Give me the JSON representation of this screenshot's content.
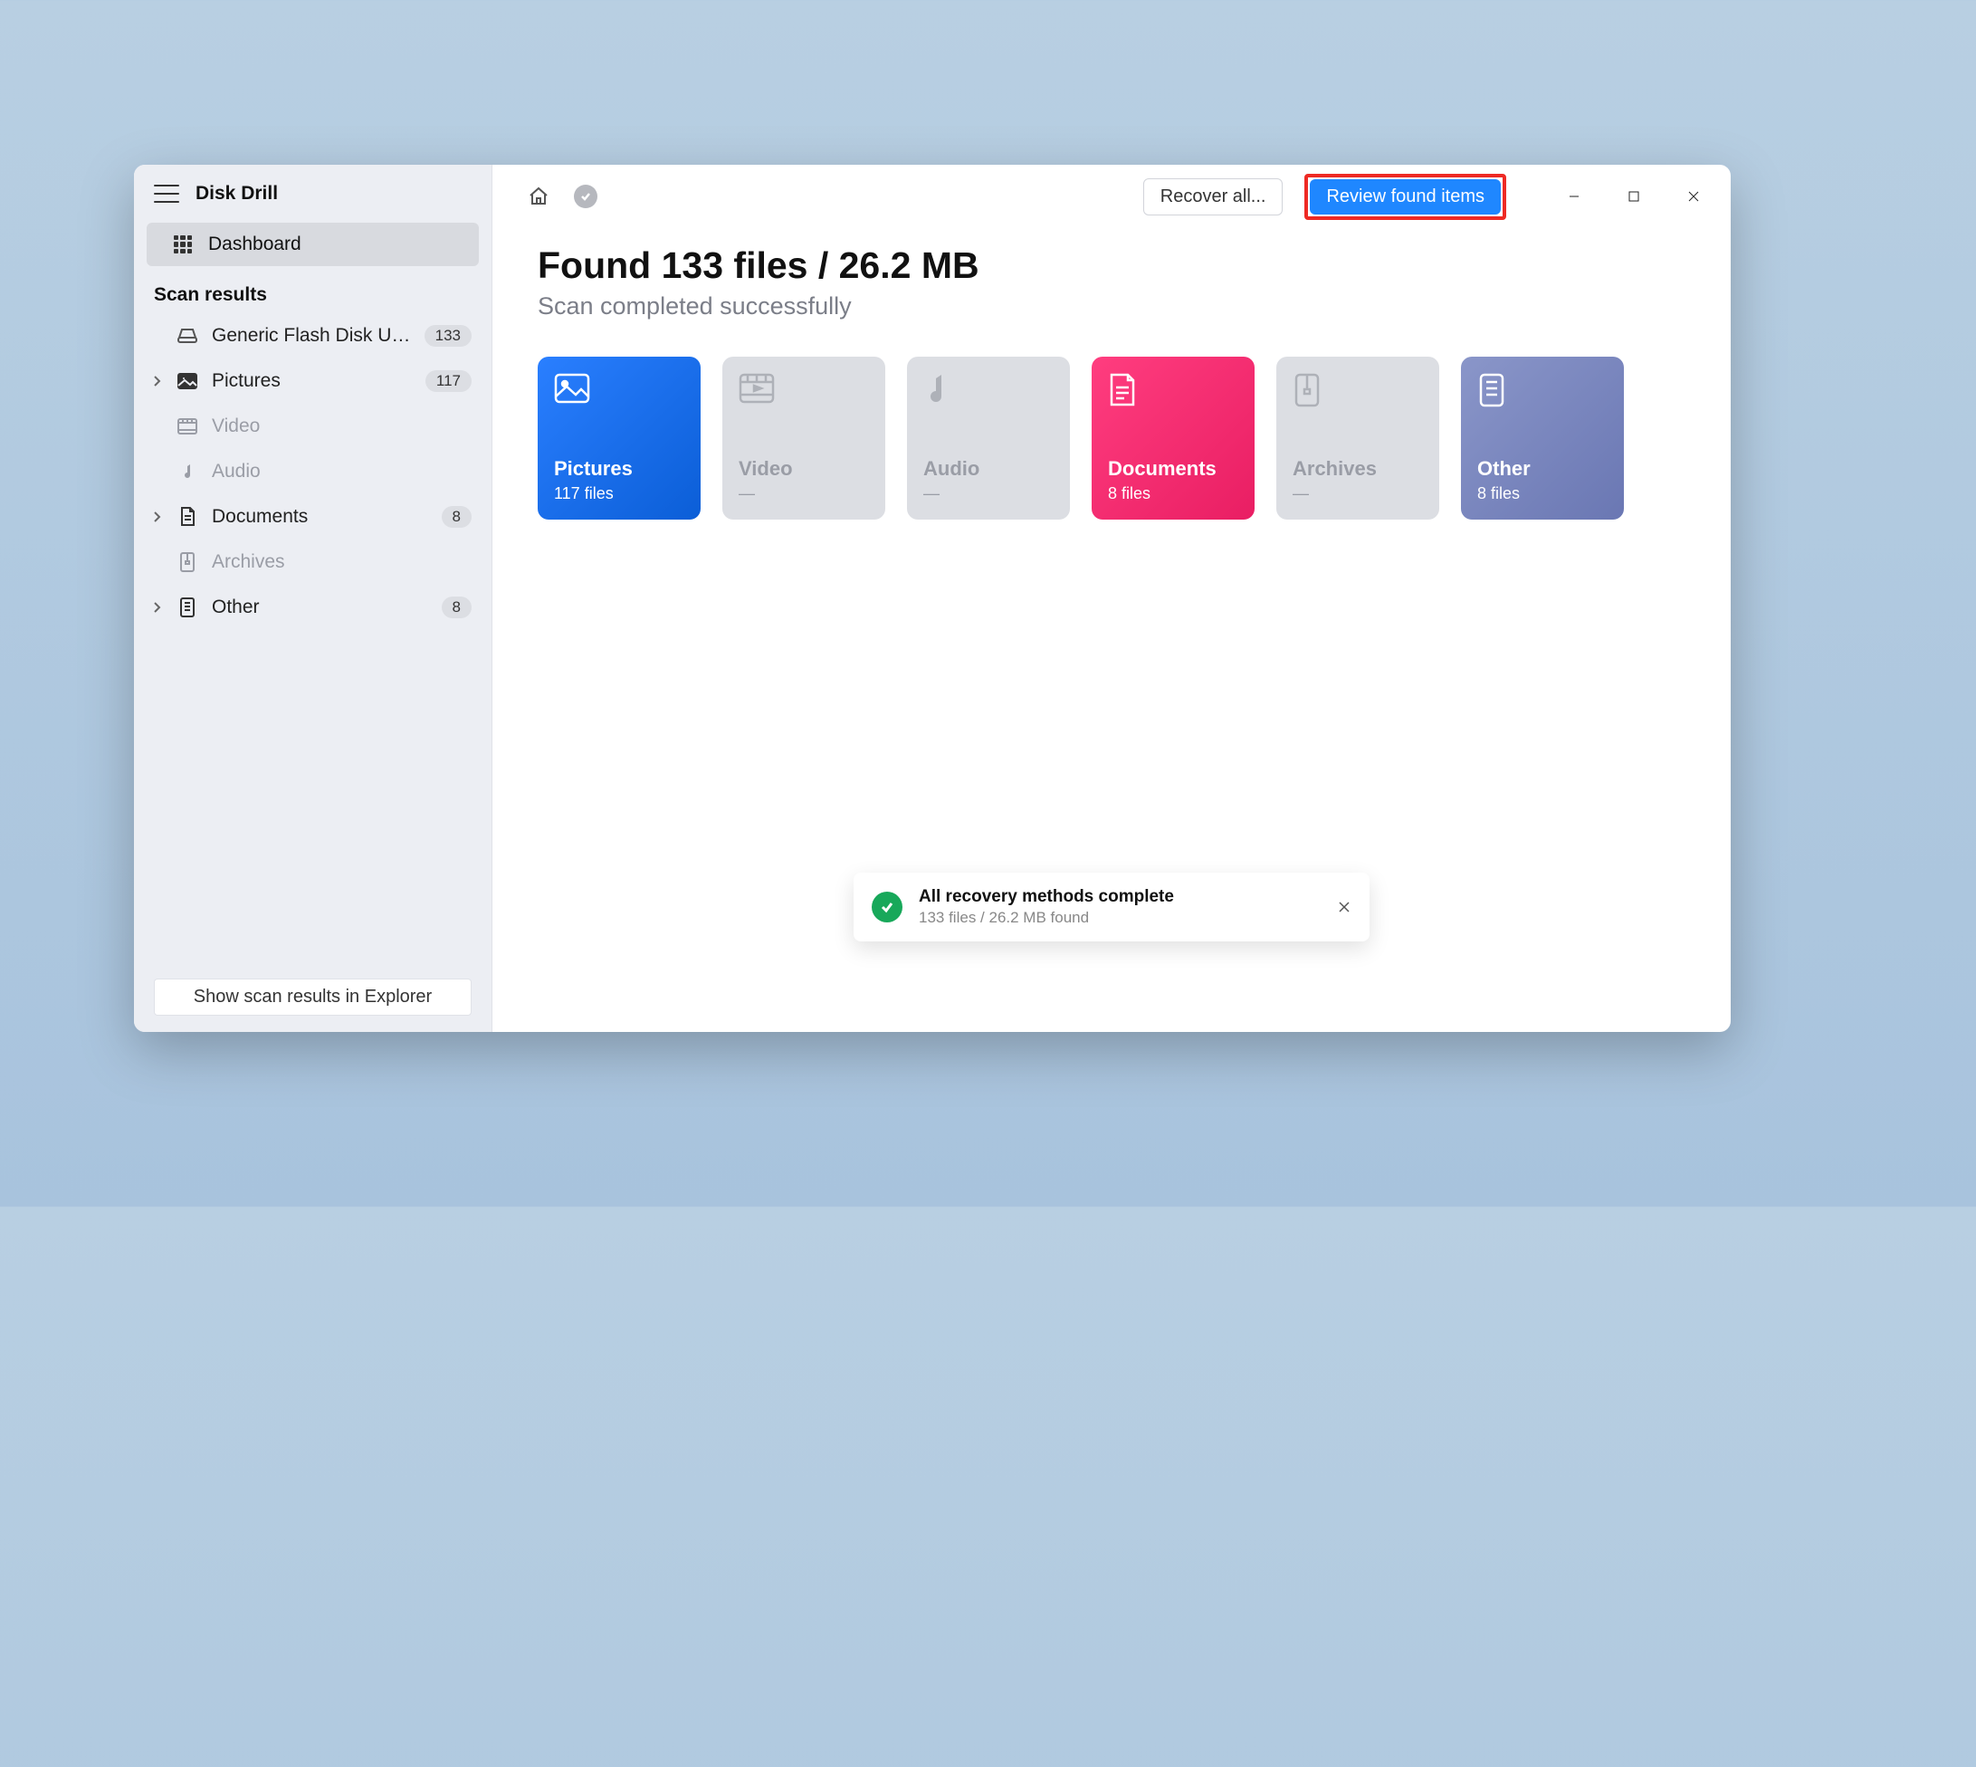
{
  "app": {
    "title": "Disk Drill"
  },
  "sidebar": {
    "dashboard_label": "Dashboard",
    "section_label": "Scan results",
    "items": [
      {
        "label": "Generic Flash Disk USB...",
        "badge": "133",
        "icon": "disk"
      },
      {
        "label": "Pictures",
        "badge": "117",
        "icon": "picture",
        "expandable": true
      },
      {
        "label": "Video",
        "icon": "video"
      },
      {
        "label": "Audio",
        "icon": "audio"
      },
      {
        "label": "Documents",
        "badge": "8",
        "icon": "document",
        "expandable": true
      },
      {
        "label": "Archives",
        "icon": "archive"
      },
      {
        "label": "Other",
        "badge": "8",
        "icon": "other",
        "expandable": true
      }
    ],
    "footer_button": "Show scan results in Explorer"
  },
  "toolbar": {
    "recover_all": "Recover all...",
    "review": "Review found items"
  },
  "headline": {
    "title": "Found 133 files / 26.2 MB",
    "subtitle": "Scan completed successfully"
  },
  "cards": [
    {
      "key": "pictures",
      "title": "Pictures",
      "subtitle": "117 files"
    },
    {
      "key": "video",
      "title": "Video",
      "subtitle": "—"
    },
    {
      "key": "audio",
      "title": "Audio",
      "subtitle": "—"
    },
    {
      "key": "documents",
      "title": "Documents",
      "subtitle": "8 files"
    },
    {
      "key": "archives",
      "title": "Archives",
      "subtitle": "—"
    },
    {
      "key": "other",
      "title": "Other",
      "subtitle": "8 files"
    }
  ],
  "toast": {
    "title": "All recovery methods complete",
    "subtitle": "133 files / 26.2 MB found"
  }
}
